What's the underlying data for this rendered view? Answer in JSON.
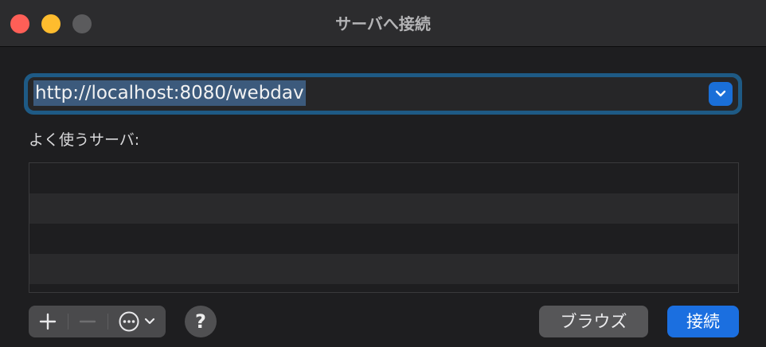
{
  "window": {
    "title": "サーバへ接続"
  },
  "server": {
    "address": "http://localhost:8080/webdav"
  },
  "favorites": {
    "label": "よく使うサーバ:",
    "items": []
  },
  "toolbar": {
    "add_icon": "plus-icon",
    "remove_icon": "minus-icon",
    "more_icon": "ellipsis-circle-icon",
    "help_label": "?"
  },
  "buttons": {
    "browse": "ブラウズ",
    "connect": "接続"
  },
  "colors": {
    "accent": "#1b6fe0",
    "focus_ring": "#1e5a85",
    "close": "#fe5f57",
    "minimize": "#febc2e"
  }
}
